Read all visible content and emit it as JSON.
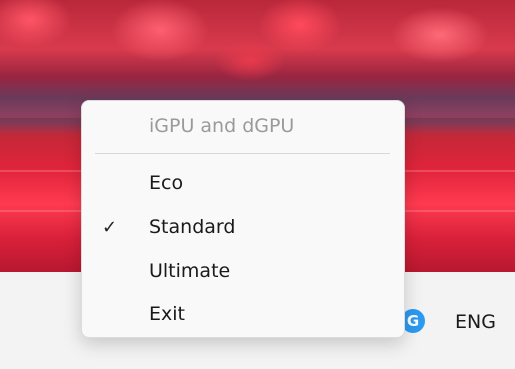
{
  "menu": {
    "header": "iGPU and dGPU",
    "items": [
      {
        "label": "Eco",
        "checked": false
      },
      {
        "label": "Standard",
        "checked": true
      },
      {
        "label": "Ultimate",
        "checked": false
      },
      {
        "label": "Exit",
        "checked": false
      }
    ],
    "check_glyph": "✓"
  },
  "tray": {
    "app_icon": "g-circle-icon",
    "app_icon_letter": "G",
    "app_icon_color": "#2b9af3",
    "language": "ENG"
  }
}
